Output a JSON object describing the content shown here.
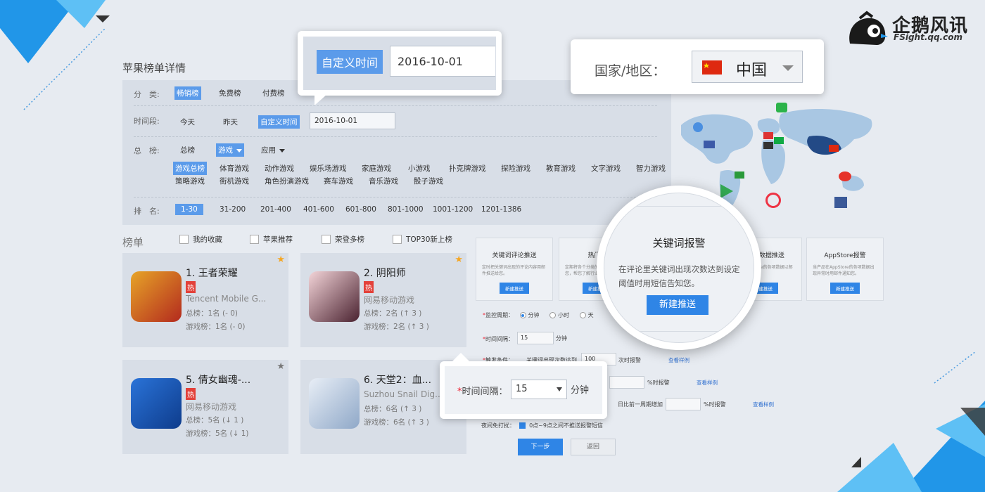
{
  "brand": {
    "name": "企鹅风讯",
    "url_text": "FSight.qq.com"
  },
  "page_title": "苹果榜单详情",
  "filter": {
    "category_label": "分　类:",
    "categories": [
      "畅销榜",
      "免费榜",
      "付费榜"
    ],
    "period_label": "时间段:",
    "periods": [
      "今天",
      "昨天",
      "自定义时间"
    ],
    "date_value": "2016-10-01",
    "chart_label": "总　榜:",
    "chart_types": [
      "总榜",
      "游戏",
      "应用"
    ],
    "genres": [
      "游戏总榜",
      "体育游戏",
      "动作游戏",
      "娱乐场游戏",
      "家庭游戏",
      "小游戏",
      "扑克牌游戏",
      "探险游戏",
      "教育游戏",
      "文字游戏",
      "智力游戏",
      "策略游戏",
      "街机游戏",
      "角色扮演游戏",
      "赛车游戏",
      "音乐游戏",
      "骰子游戏"
    ],
    "rank_label": "排　名:",
    "ranks": [
      "1-30",
      "31-200",
      "201-400",
      "401-600",
      "601-800",
      "801-1000",
      "1001-1200",
      "1201-1386"
    ]
  },
  "list": {
    "title": "榜单",
    "checks": [
      "我的收藏",
      "苹果推荐",
      "荣登多榜",
      "TOP30新上榜"
    ],
    "hot": "热",
    "apps": [
      {
        "name": "1. 王者荣耀",
        "dev": "Tencent Mobile G...",
        "total": "总榜：1名 (- 0)",
        "game": "游戏榜：1名 (- 0)",
        "star": "★"
      },
      {
        "name": "2. 阴阳师",
        "dev": "网易移动游戏",
        "total": "总榜：2名 (↑ 3 )",
        "game": "游戏榜：2名 (↑ 3 )",
        "star": "★"
      },
      {
        "name": "5. 倩女幽魂-...",
        "dev": "网易移动游戏",
        "total": "总榜：5名 (↓ 1 )",
        "game": "游戏榜：5名 (↓ 1)",
        "star": "★"
      },
      {
        "name": "6. 天堂2：血...",
        "dev": "Suzhou Snail Dig...",
        "total": "总榜：6名 (↑ 3 )",
        "game": "游戏榜：6名 (↑ 3 )",
        "star": ""
      }
    ]
  },
  "push": {
    "cards": [
      {
        "title": "关键词评论推送",
        "desc": "定时把关键词出现的评论内容用邮件推送给您。",
        "btn": "新建推送"
      },
      {
        "title": "热门榜",
        "desc": "定期将各个分类的榜单邮件推送给您，帮您了解行业最新资讯。",
        "btn": "新建推送"
      },
      {
        "title": "Store数据推送",
        "desc": "定时将AppStore的各项数据以邮件推送给您。",
        "btn": "新建推送"
      },
      {
        "title": "AppStore报警",
        "desc": "当产品在AppStore的各项数据出现异常时用邮件通知您。",
        "btn": "新建推送"
      }
    ],
    "period_label": "监控周期：",
    "period_options": [
      "分钟",
      "小时",
      "天"
    ],
    "interval_label": "时间间隔：",
    "interval_value": "15",
    "interval_unit": "分钟",
    "trigger_label": "触发条件：",
    "trigger_text": "关键词出现次数达到",
    "trigger_value": "100",
    "trigger_suffix": "次时报警",
    "pct_suffix": "%时报警",
    "compare_text": "日比前一周期增加",
    "example_link": "查看样例",
    "night_label": "夜间免打扰：",
    "night_text": "0点~9点之间不推送报警短信",
    "next_btn": "下一步",
    "back_btn": "返回"
  },
  "callouts": {
    "date_label": "自定义时间",
    "date_value": "2016-10-01",
    "region_label": "国家/地区：",
    "region_value": "中国",
    "interval_label": "时间间隔：",
    "interval_value": "15",
    "interval_unit": "分钟",
    "mag_title": "关键词报警",
    "mag_desc": "在评论里关键词出现次数达到设定阈值时用短信告知您。",
    "mag_btn": "新建推送"
  },
  "colors": {
    "accent": "#2f85e6",
    "selected": "#5b9bea",
    "hot": "#e3413a",
    "star": "#f5a623",
    "bg": "#e7ebf1"
  }
}
